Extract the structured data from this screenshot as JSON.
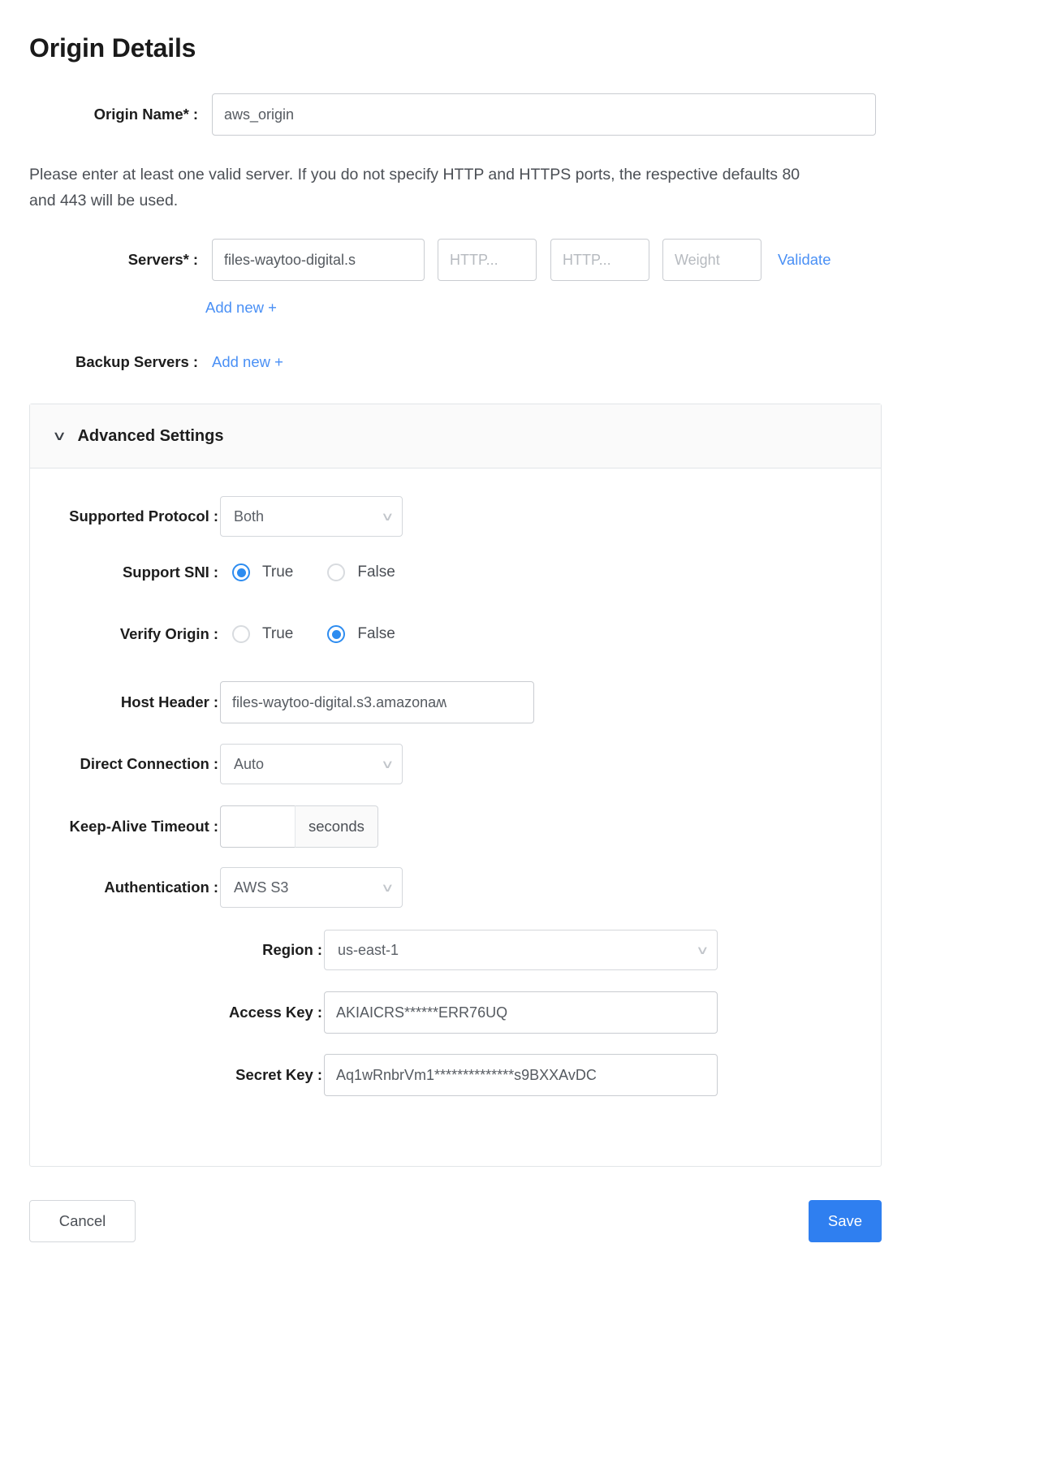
{
  "page": {
    "title": "Origin Details",
    "helper_text": "Please enter at least one valid server. If you do not specify HTTP and HTTPS ports, the respective defaults 80 and 443 will be used."
  },
  "origin_name": {
    "label": "Origin Name",
    "required_mark": "*",
    "colon": ":",
    "value": "aws_origin"
  },
  "servers": {
    "label": "Servers",
    "required_mark": "*",
    "colon": ":",
    "address_value": "files-waytoo-digital.s",
    "http_port_placeholder": "HTTP...",
    "https_port_placeholder": "HTTP...",
    "weight_placeholder": "Weight",
    "validate_label": "Validate",
    "add_new_label": "Add new +"
  },
  "backup_servers": {
    "label": "Backup Servers",
    "colon": ":",
    "add_new_label": "Add new +"
  },
  "advanced": {
    "header_label": "Advanced Settings",
    "chevron": "∨",
    "supported_protocol": {
      "label": "Supported Protocol",
      "colon": ":",
      "value": "Both",
      "caret": "∨"
    },
    "support_sni": {
      "label": "Support SNI",
      "colon": ":",
      "true_label": "True",
      "false_label": "False",
      "selected": "True"
    },
    "verify_origin": {
      "label": "Verify Origin",
      "colon": ":",
      "true_label": "True",
      "false_label": "False",
      "selected": "False"
    },
    "host_header": {
      "label": "Host Header",
      "colon": ":",
      "value": "files-waytoo-digital.s3.amazonaʍ"
    },
    "direct_connection": {
      "label": "Direct Connection",
      "colon": ":",
      "value": "Auto",
      "caret": "∨"
    },
    "keep_alive_timeout": {
      "label": "Keep-Alive Timeout",
      "colon": ":",
      "value": "",
      "unit": "seconds"
    },
    "authentication": {
      "label": "Authentication",
      "colon": ":",
      "value": "AWS S3",
      "caret": "∨"
    },
    "region": {
      "label": "Region",
      "colon": ":",
      "value": "us-east-1",
      "caret": "∨"
    },
    "access_key": {
      "label": "Access Key",
      "colon": ":",
      "value": "AKIAICRS******ERR76UQ"
    },
    "secret_key": {
      "label": "Secret Key",
      "colon": ":",
      "value": "Aq1wRnbrVm1**************s9BXXAvDC"
    }
  },
  "footer": {
    "cancel_label": "Cancel",
    "save_label": "Save"
  },
  "colors": {
    "link_blue": "#4a90f5",
    "primary_blue": "#2f7ff0",
    "radio_blue": "#2d8cf0"
  }
}
